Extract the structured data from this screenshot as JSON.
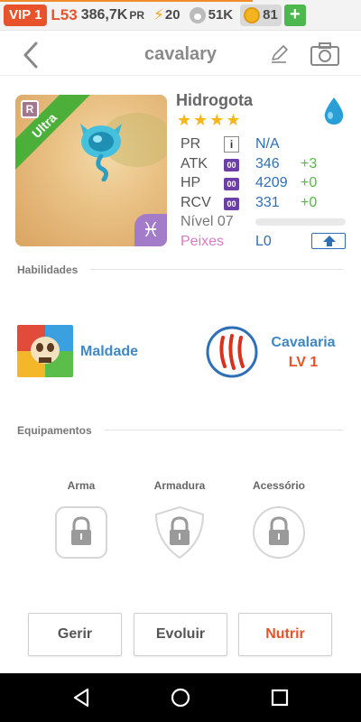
{
  "status_bar": {
    "vip": "VIP 1",
    "level": "L53",
    "pr_value": "386,7K",
    "pr_unit": "PR",
    "energy": "20",
    "food": "51K",
    "coins": "81",
    "add_label": "+"
  },
  "header": {
    "title": "cavalary"
  },
  "monster": {
    "name": "Hidrogota",
    "stars": "★★★★",
    "ribbon": "Ultra",
    "rarity_badge": "R",
    "zodiac": "♓",
    "element_color": "#2a9fd6"
  },
  "stats": [
    {
      "label": "PR",
      "icon": "i",
      "value": "N/A",
      "bonus": ""
    },
    {
      "label": "ATK",
      "icon": "00",
      "value": "346",
      "bonus": "+3"
    },
    {
      "label": "HP",
      "icon": "00",
      "value": "4209",
      "bonus": "+0"
    },
    {
      "label": "RCV",
      "icon": "00",
      "value": "331",
      "bonus": "+0"
    }
  ],
  "level_row": {
    "label": "Nível 07",
    "progress": 0
  },
  "fish_row": {
    "label": "Peixes",
    "value": "L0"
  },
  "sections": {
    "skills": "Habilidades",
    "equipment": "Equipamentos"
  },
  "skills": {
    "active": {
      "name": "Maldade"
    },
    "leader": {
      "name": "Cavalaria",
      "level": "LV 1"
    }
  },
  "equipment": [
    {
      "label": "Arma"
    },
    {
      "label": "Armadura"
    },
    {
      "label": "Acessório"
    }
  ],
  "actions": {
    "manage": "Gerir",
    "evolve": "Evoluir",
    "feed": "Nutrir"
  },
  "colors": {
    "accent_orange": "#e8532b",
    "link_blue": "#3f88c6",
    "bonus_green": "#58b848",
    "fish_pink": "#d77bc6"
  }
}
